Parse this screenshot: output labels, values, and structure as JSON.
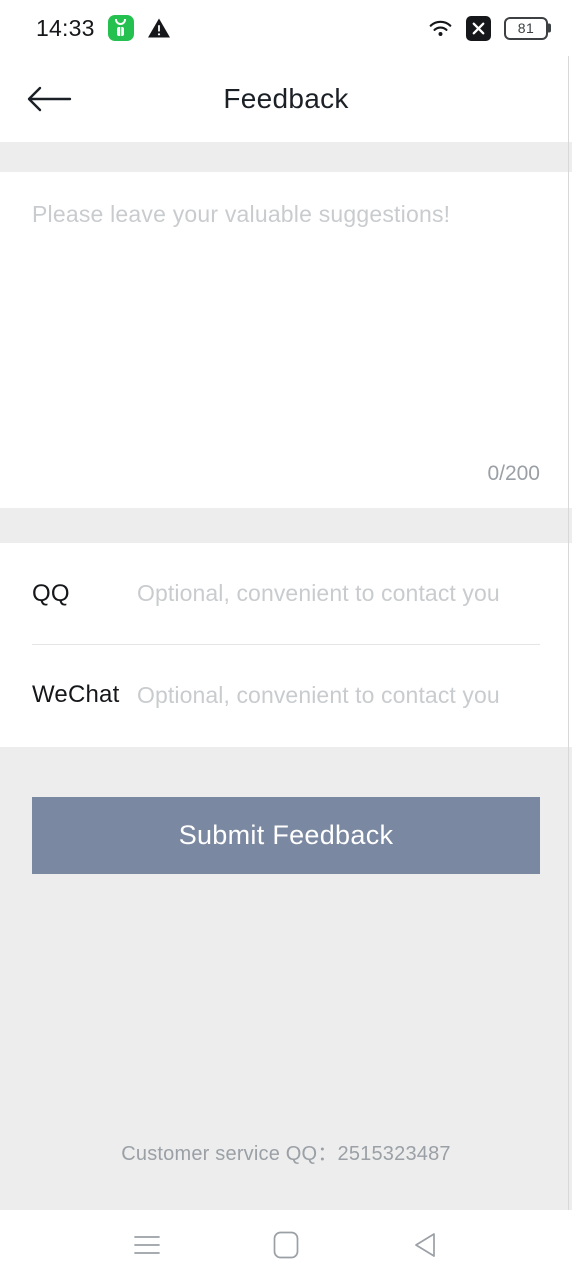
{
  "status_bar": {
    "time": "14:33",
    "app_badge_icon": "restaurant-app-icon",
    "warning_icon": "warning-triangle-icon",
    "wifi_icon": "wifi-icon",
    "no_signal_icon": "signal-x-icon",
    "battery_level": "81"
  },
  "header": {
    "back_icon": "back-arrow-icon",
    "title": "Feedback"
  },
  "feedback": {
    "placeholder": "Please leave your valuable suggestions!",
    "value": "",
    "counter": "0/200",
    "max_length": "200"
  },
  "contact": {
    "rows": [
      {
        "label": "QQ",
        "placeholder": "Optional, convenient to contact you",
        "value": ""
      },
      {
        "label": "WeChat",
        "placeholder": "Optional, convenient to contact you",
        "value": ""
      }
    ]
  },
  "submit": {
    "label": "Submit Feedback",
    "color": "#7b88a1"
  },
  "footer": {
    "customer_service": "Customer service QQ：2515323487"
  },
  "android_nav": {
    "recents_icon": "menu-lines-icon",
    "home_icon": "home-square-icon",
    "back_icon": "back-triangle-icon"
  },
  "colors": {
    "background": "#ededed",
    "card": "#ffffff",
    "accent": "#7b88a1",
    "placeholder": "#c9cccf",
    "text": "#15171a"
  }
}
